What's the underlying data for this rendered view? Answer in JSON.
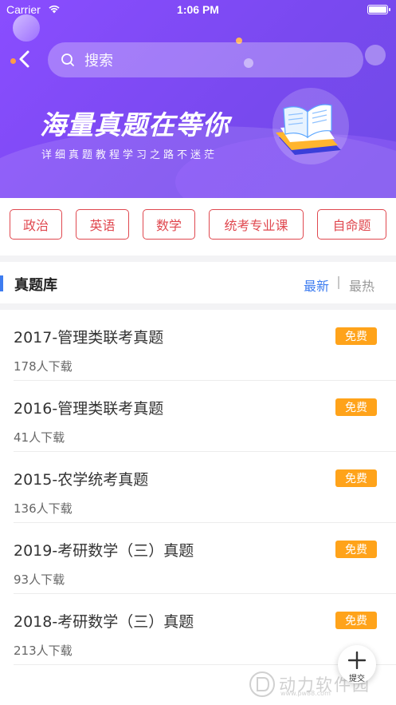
{
  "status_bar": {
    "carrier": "Carrier",
    "time": "1:06 PM"
  },
  "header": {
    "search_placeholder": "搜索",
    "banner_title": "海量真题在等你",
    "banner_subtitle": "详细真题教程学习之路不迷茫",
    "gradient_colors": [
      "#8a4dff",
      "#6f4ae6"
    ]
  },
  "categories": [
    {
      "label": "政治"
    },
    {
      "label": "英语"
    },
    {
      "label": "数学"
    },
    {
      "label": "统考专业课"
    },
    {
      "label": "自命题"
    }
  ],
  "section": {
    "title": "真题库",
    "tab_latest": "最新",
    "tab_hot": "最热",
    "accent_color": "#3d7cf0"
  },
  "papers": [
    {
      "name": "2017-管理类联考真题",
      "downloads": "178人下载",
      "badge": "免费"
    },
    {
      "name": "2016-管理类联考真题",
      "downloads": "41人下载",
      "badge": "免费"
    },
    {
      "name": "2015-农学统考真题",
      "downloads": "136人下载",
      "badge": "免费"
    },
    {
      "name": "2019-考研数学（三）真题",
      "downloads": "93人下载",
      "badge": "免费"
    },
    {
      "name": "2018-考研数学（三）真题",
      "downloads": "213人下载",
      "badge": "免费"
    }
  ],
  "fab": {
    "label": "提交",
    "icon": "plus-icon"
  },
  "watermark": {
    "text": "动力软件园",
    "url": "www.pw88.com"
  }
}
